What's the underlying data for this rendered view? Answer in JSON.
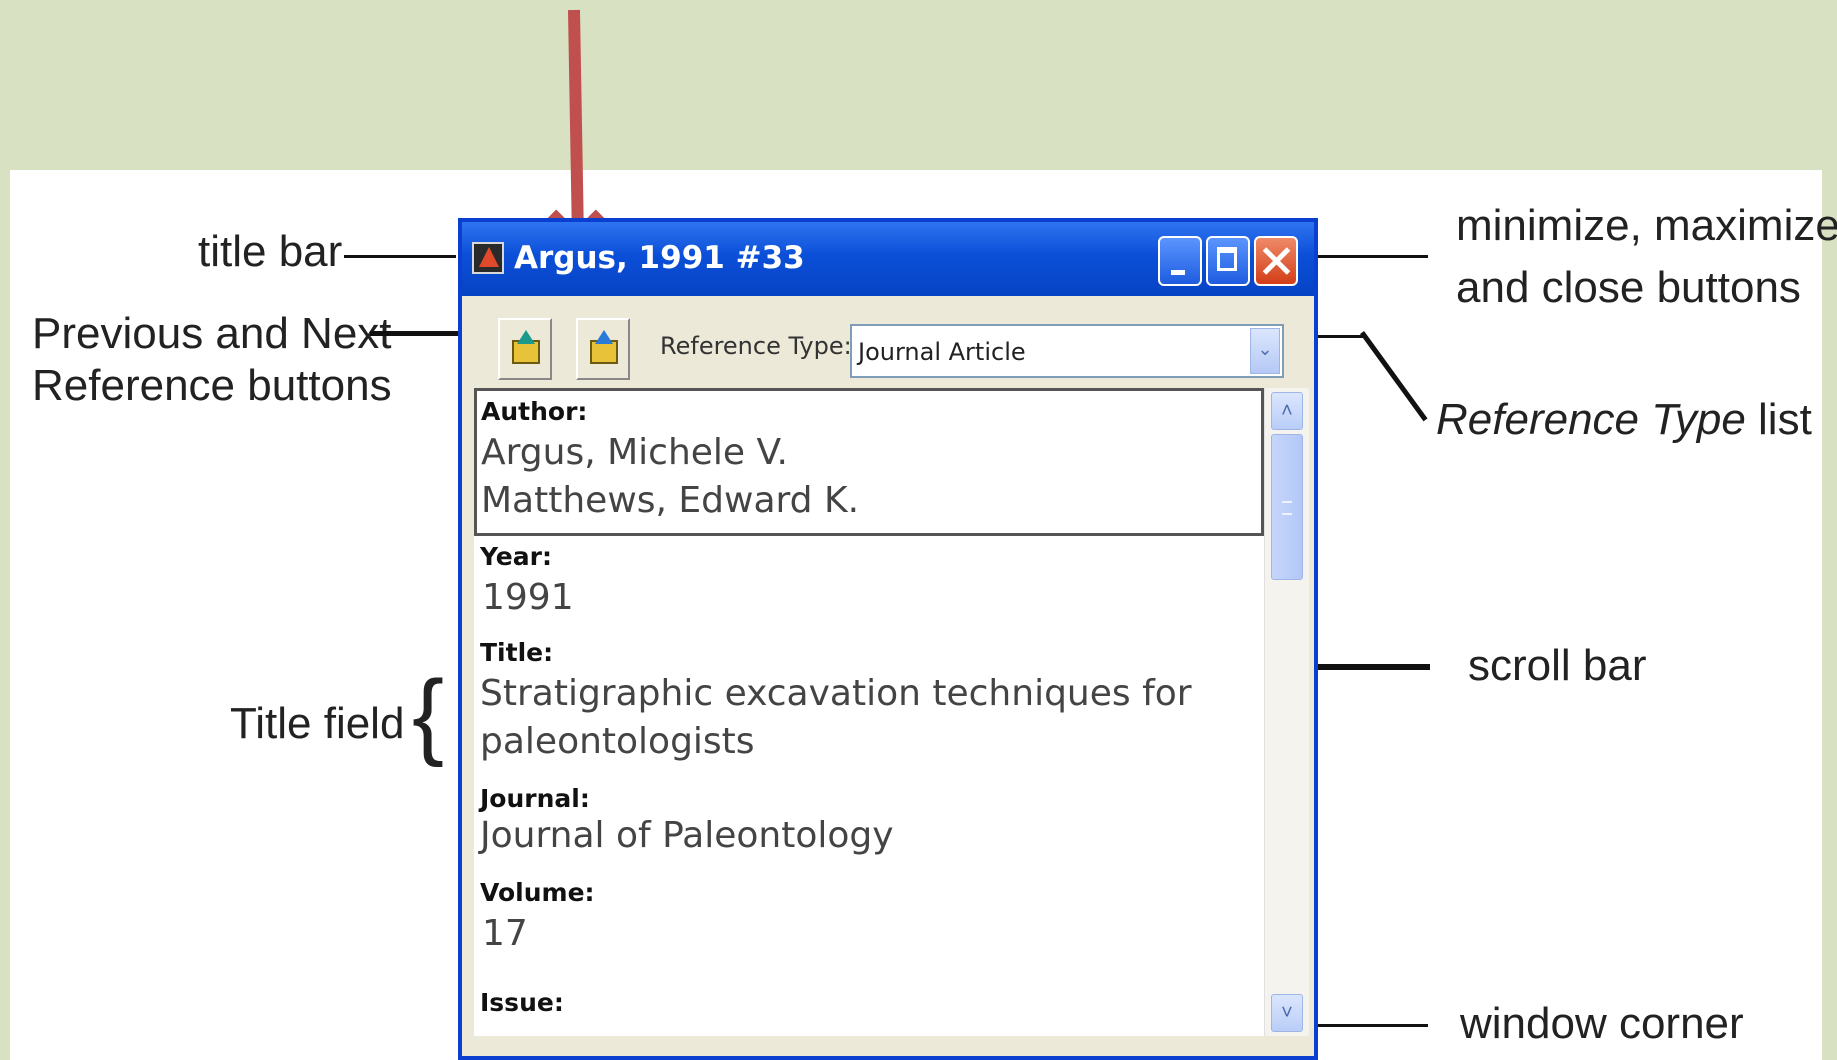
{
  "window": {
    "title": "Argus, 1991 #33",
    "reference_type_label": "Reference Type:",
    "reference_type_value": "Journal Article",
    "dropdown_glyph": "⌄",
    "scroll_up_glyph": "˄",
    "scroll_down_glyph": "˅"
  },
  "fields": {
    "author_label": "Author:",
    "author_1": "Argus, Michele V.",
    "author_2": "Matthews, Edward K.",
    "year_label": "Year:",
    "year_value": "1991",
    "title_label": "Title:",
    "title_line1": "Stratigraphic excavation techniques for",
    "title_line2": "paleontologists",
    "journal_label": "Journal:",
    "journal_value": "Journal of Paleontology",
    "volume_label": "Volume:",
    "volume_value": "17",
    "issue_label": "Issue:"
  },
  "annotations": {
    "title_bar": "title bar",
    "prev_next_1": "Previous and Next",
    "prev_next_2": "Reference buttons",
    "window_buttons_1": "minimize, maximize,",
    "window_buttons_2": "and close buttons",
    "reference_type_italic": "Reference Type",
    "reference_type_rest": "list",
    "title_field": "Title field",
    "title_brace": "{",
    "scroll_bar": "scroll bar",
    "window_corner": "window corner"
  },
  "colors": {
    "page_background": "#d8e2c2",
    "title_bar_blue": "#0b4fd8",
    "close_red": "#d23e18",
    "pointer_arrow": "#c0504d"
  },
  "icons": [
    "app-icon",
    "minimize-icon",
    "maximize-icon",
    "close-icon",
    "previous-reference-icon",
    "next-reference-icon",
    "dropdown-arrow-icon",
    "scroll-up-icon",
    "scroll-down-icon"
  ]
}
